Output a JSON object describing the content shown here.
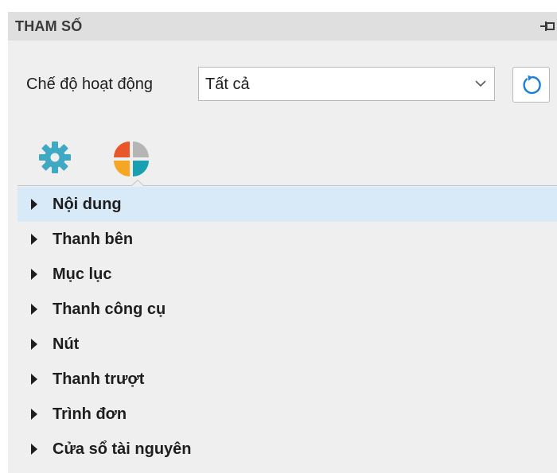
{
  "panel": {
    "title": "THAM SỐ",
    "pin_icon": "pin-icon"
  },
  "mode": {
    "label": "Chế độ hoạt động",
    "selected": "Tất cả",
    "dropdown_icon": "chevron-down-icon",
    "reset_icon": "refresh-icon"
  },
  "tabs": [
    {
      "icon": "gear-icon",
      "selected": false
    },
    {
      "icon": "theme-palette-icon",
      "selected": true
    }
  ],
  "colors": {
    "gear": "#3fa9c4",
    "palette": [
      "#e8562a",
      "#b5b5b5",
      "#f5a623",
      "#19a0b0"
    ],
    "selected_row": "#d8e9f8",
    "reset_icon": "#1c7ed6"
  },
  "tree": {
    "items": [
      {
        "label": "Nội dung",
        "selected": true
      },
      {
        "label": "Thanh bên",
        "selected": false
      },
      {
        "label": "Mục lục",
        "selected": false
      },
      {
        "label": "Thanh công cụ",
        "selected": false
      },
      {
        "label": "Nút",
        "selected": false
      },
      {
        "label": "Thanh trượt",
        "selected": false
      },
      {
        "label": "Trình đơn",
        "selected": false
      },
      {
        "label": "Cửa sổ tài nguyên",
        "selected": false
      }
    ]
  }
}
